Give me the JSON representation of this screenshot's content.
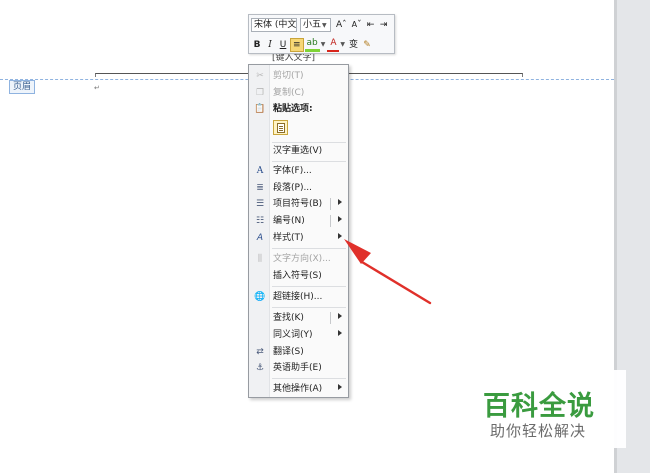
{
  "document": {
    "header_tag": "页眉",
    "header_placeholder": "[键入文字]",
    "paragraph_mark": "↵"
  },
  "mini_toolbar": {
    "font_name": "宋体 (中文",
    "font_size": "小五",
    "grow_font": "A",
    "shrink_font": "A",
    "decrease_indent": "⇤",
    "increase_indent": "⇥",
    "bold": "B",
    "italic": "I",
    "underline": "U",
    "center": "≡",
    "highlight": "ab",
    "font_color": "A",
    "phonetic": "变",
    "format_painter": "✎"
  },
  "context_menu": {
    "items": [
      {
        "label": "剪切(T)",
        "icon": "scissors-icon",
        "disabled": true
      },
      {
        "label": "复制(C)",
        "icon": "copy-icon",
        "disabled": true
      },
      {
        "label": "粘贴选项:",
        "icon": "clipboard-icon",
        "section": true
      },
      {
        "label": "汉字重选(V)"
      },
      {
        "label": "字体(F)...",
        "icon": "font-icon"
      },
      {
        "label": "段落(P)...",
        "icon": "paragraph-icon"
      },
      {
        "label": "项目符号(B)",
        "icon": "bullets-icon",
        "submenu": true,
        "split": true
      },
      {
        "label": "编号(N)",
        "icon": "numbering-icon",
        "submenu": true,
        "split": true
      },
      {
        "label": "样式(T)",
        "icon": "styles-icon",
        "submenu": true
      },
      {
        "label": "文字方向(X)...",
        "icon": "text-direction-icon",
        "disabled": true
      },
      {
        "label": "插入符号(S)"
      },
      {
        "label": "超链接(H)...",
        "icon": "hyperlink-icon"
      },
      {
        "label": "查找(K)",
        "submenu": true,
        "split": true
      },
      {
        "label": "同义词(Y)",
        "submenu": true
      },
      {
        "label": "翻译(S)",
        "icon": "translate-icon"
      },
      {
        "label": "英语助手(E)",
        "icon": "english-assistant-icon"
      },
      {
        "label": "其他操作(A)",
        "submenu": true
      }
    ]
  },
  "watermark": {
    "title": "百科全说",
    "subtitle": "助你轻松解决"
  },
  "colors": {
    "annotation_arrow": "#e0302a",
    "watermark_green": "#3a9b3f",
    "header_guide": "#8fb3e0"
  }
}
